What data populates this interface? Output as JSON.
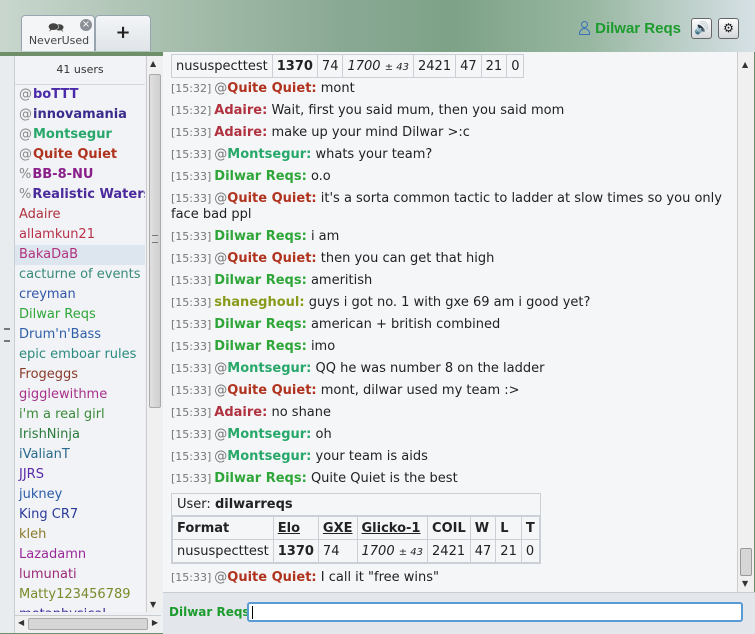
{
  "header": {
    "room_tab": {
      "bubble_icon": "speech-bubble-icon",
      "close_icon": "close-icon",
      "label": "NeverUsed"
    },
    "add_tab_label": "+",
    "username": "Dilwar Reqs",
    "sound_icon": "🔊",
    "settings_icon": "⚙"
  },
  "userlist": {
    "count": "41 users",
    "users": [
      {
        "group": "@",
        "name": "boTTT",
        "color": "#4a2aa8",
        "bold": true
      },
      {
        "group": "@",
        "name": "innovamania",
        "color": "#3a2c8c",
        "bold": true
      },
      {
        "group": "@",
        "name": "Montsegur",
        "color": "#27a86a",
        "bold": true
      },
      {
        "group": "@",
        "name": "Quite Quiet",
        "color": "#b0331e",
        "bold": true
      },
      {
        "group": "%",
        "name": "BB-8-NU",
        "color": "#8a1f8a",
        "bold": true
      },
      {
        "group": "%",
        "name": "Realistic Waters",
        "color": "#4b2a9c",
        "bold": true
      },
      {
        "group": "",
        "name": "Adaire",
        "color": "#b0323f",
        "bold": false
      },
      {
        "group": "",
        "name": "allamkun21",
        "color": "#b8324a",
        "bold": false
      },
      {
        "group": "",
        "name": "BakaDaB",
        "color": "#b0347e",
        "bold": false,
        "highlight": true
      },
      {
        "group": "",
        "name": "cacturne of events",
        "color": "#3a8a7a",
        "bold": false
      },
      {
        "group": "",
        "name": "creyman",
        "color": "#3156a8",
        "bold": false
      },
      {
        "group": "",
        "name": "Dilwar Reqs",
        "color": "#2ea638",
        "bold": false
      },
      {
        "group": "",
        "name": "Drum'n'Bass",
        "color": "#2f5fa8",
        "bold": false
      },
      {
        "group": "",
        "name": "epic emboar rules",
        "color": "#2c8a7e",
        "bold": false
      },
      {
        "group": "",
        "name": "Frogeggs",
        "color": "#8a3a2a",
        "bold": false
      },
      {
        "group": "",
        "name": "gigglewithme",
        "color": "#a8308a",
        "bold": false
      },
      {
        "group": "",
        "name": "i'm a real girl",
        "color": "#3a8a3a",
        "bold": false
      },
      {
        "group": "",
        "name": "IrishNinja",
        "color": "#2a7a3a",
        "bold": false
      },
      {
        "group": "",
        "name": "iValianT",
        "color": "#2a6a8a",
        "bold": false
      },
      {
        "group": "",
        "name": "JJRS",
        "color": "#5a2aa8",
        "bold": false
      },
      {
        "group": "",
        "name": "jukney",
        "color": "#2a5aa8",
        "bold": false
      },
      {
        "group": "",
        "name": "King CR7",
        "color": "#2a3a9a",
        "bold": false
      },
      {
        "group": "",
        "name": "kleh",
        "color": "#8a7a2a",
        "bold": false
      },
      {
        "group": "",
        "name": "Lazadamn",
        "color": "#9a2a9a",
        "bold": false
      },
      {
        "group": "",
        "name": "lumunati",
        "color": "#9a2a7a",
        "bold": false
      },
      {
        "group": "",
        "name": "Matty123456789",
        "color": "#7a8a2a",
        "bold": false
      },
      {
        "group": "",
        "name": "metaphysical",
        "color": "#3a2a9a",
        "bold": false
      }
    ]
  },
  "ranking_top": {
    "cells": [
      "nususpecttest",
      "1370",
      "74",
      "1700",
      "± 43",
      "2421",
      "47",
      "21",
      "0"
    ]
  },
  "messages": [
    {
      "ts": "[15:32]",
      "at": "@",
      "nick": "Quite Quiet:",
      "color": "#b0331e",
      "text": "mont"
    },
    {
      "ts": "[15:32]",
      "at": "",
      "nick": "Adaire:",
      "color": "#b0323f",
      "text": "Wait, first you said mum, then you said mom"
    },
    {
      "ts": "[15:33]",
      "at": "",
      "nick": "Adaire:",
      "color": "#b0323f",
      "text": "make up your mind Dilwar >:c"
    },
    {
      "ts": "[15:33]",
      "at": "@",
      "nick": "Montsegur:",
      "color": "#27a86a",
      "text": "whats your team?"
    },
    {
      "ts": "[15:33]",
      "at": "",
      "nick": "Dilwar Reqs:",
      "color": "#2ea638",
      "text": "o.o"
    },
    {
      "ts": "[15:33]",
      "at": "@",
      "nick": "Quite Quiet:",
      "color": "#b0331e",
      "text": "it's a sorta common tactic to ladder at slow times so you only face bad ppl"
    },
    {
      "ts": "[15:33]",
      "at": "",
      "nick": "Dilwar Reqs:",
      "color": "#2ea638",
      "text": "i am"
    },
    {
      "ts": "[15:33]",
      "at": "@",
      "nick": "Quite Quiet:",
      "color": "#b0331e",
      "text": "then you can get that high"
    },
    {
      "ts": "[15:33]",
      "at": "",
      "nick": "Dilwar Reqs:",
      "color": "#2ea638",
      "text": "ameritish"
    },
    {
      "ts": "[15:33]",
      "at": "",
      "nick": "shaneghoul:",
      "color": "#8a9a1a",
      "text": "guys i got no. 1 with gxe 69 am i good yet?"
    },
    {
      "ts": "[15:33]",
      "at": "",
      "nick": "Dilwar Reqs:",
      "color": "#2ea638",
      "text": "american + british combined"
    },
    {
      "ts": "[15:33]",
      "at": "",
      "nick": "Dilwar Reqs:",
      "color": "#2ea638",
      "text": "imo"
    },
    {
      "ts": "[15:33]",
      "at": "@",
      "nick": "Montsegur:",
      "color": "#27a86a",
      "text": "QQ he was number 8 on the ladder"
    },
    {
      "ts": "[15:33]",
      "at": "@",
      "nick": "Quite Quiet:",
      "color": "#b0331e",
      "text": "mont, dilwar used my team :>"
    },
    {
      "ts": "[15:33]",
      "at": "",
      "nick": "Adaire:",
      "color": "#b0323f",
      "text": "no shane"
    },
    {
      "ts": "[15:33]",
      "at": "@",
      "nick": "Montsegur:",
      "color": "#27a86a",
      "text": "oh"
    },
    {
      "ts": "[15:33]",
      "at": "@",
      "nick": "Montsegur:",
      "color": "#27a86a",
      "text": "your team is aids"
    },
    {
      "ts": "[15:33]",
      "at": "",
      "nick": "Dilwar Reqs:",
      "color": "#2ea638",
      "text": "Quite Quiet is the best"
    }
  ],
  "ranking": {
    "user_label": "User:",
    "user": "dilwarreqs",
    "headers": [
      "Format",
      "Elo",
      "GXE",
      "Glicko-1",
      "COIL",
      "W",
      "L",
      "T"
    ],
    "row": [
      "nususpecttest",
      "1370",
      "74",
      "1700",
      "± 43",
      "2421",
      "47",
      "21",
      "0"
    ]
  },
  "last_message": {
    "ts": "[15:33]",
    "at": "@",
    "nick": "Quite Quiet:",
    "color": "#b0331e",
    "text": "I call it \"free wins\""
  },
  "compose": {
    "name": "Dilwar Reqs",
    "value": ""
  }
}
